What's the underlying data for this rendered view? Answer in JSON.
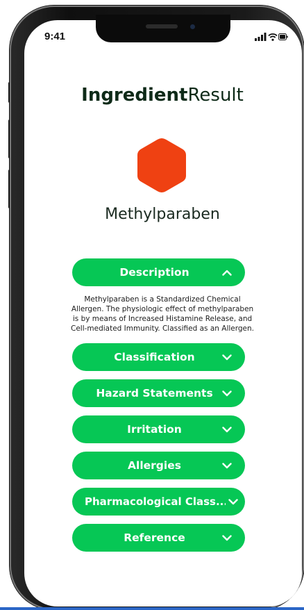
{
  "status_bar": {
    "time": "9:41",
    "icons": [
      "signal-icon",
      "wifi-icon",
      "battery-icon"
    ]
  },
  "header": {
    "title_bold": "Ingredient",
    "title_regular": "Result"
  },
  "ingredient": {
    "icon": "hexagon-icon",
    "icon_color": "#ef4112",
    "name": "Methylparaben"
  },
  "sections": [
    {
      "label": "Description",
      "expanded": true
    },
    {
      "label": "Classification",
      "expanded": false
    },
    {
      "label": "Hazard Statements",
      "expanded": false
    },
    {
      "label": "Irritation",
      "expanded": false
    },
    {
      "label": "Allergies",
      "expanded": false
    },
    {
      "label": "Pharmacological Class...",
      "expanded": false
    },
    {
      "label": "Reference",
      "expanded": false
    }
  ],
  "description": {
    "text": "Methylparaben is a Standardized Chemical Allergen. The physiologic effect of methylparaben is by means of Increased Histamine Release, and Cell-mediated Immunity. Classified as an Allergen."
  },
  "colors": {
    "accent": "#06c755",
    "title": "#0e2a18",
    "hexagon": "#ef4112"
  }
}
